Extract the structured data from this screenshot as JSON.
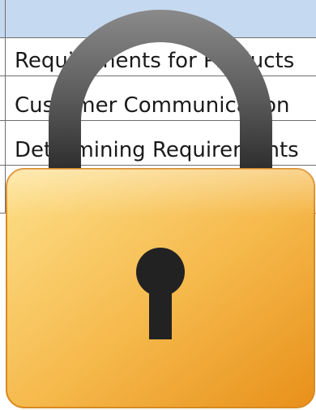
{
  "table": {
    "rows": [
      {
        "text": "Requirements for Products"
      },
      {
        "text": "Customer Communication"
      },
      {
        "text": "Determining Requirements"
      },
      {
        "text": ""
      }
    ]
  },
  "lock_icon": {
    "name": "padlock-icon",
    "body_color_light": "#fde08a",
    "body_color_dark": "#e8901a",
    "shackle_color": "#5a5a5a",
    "keyhole_color": "#222222"
  }
}
